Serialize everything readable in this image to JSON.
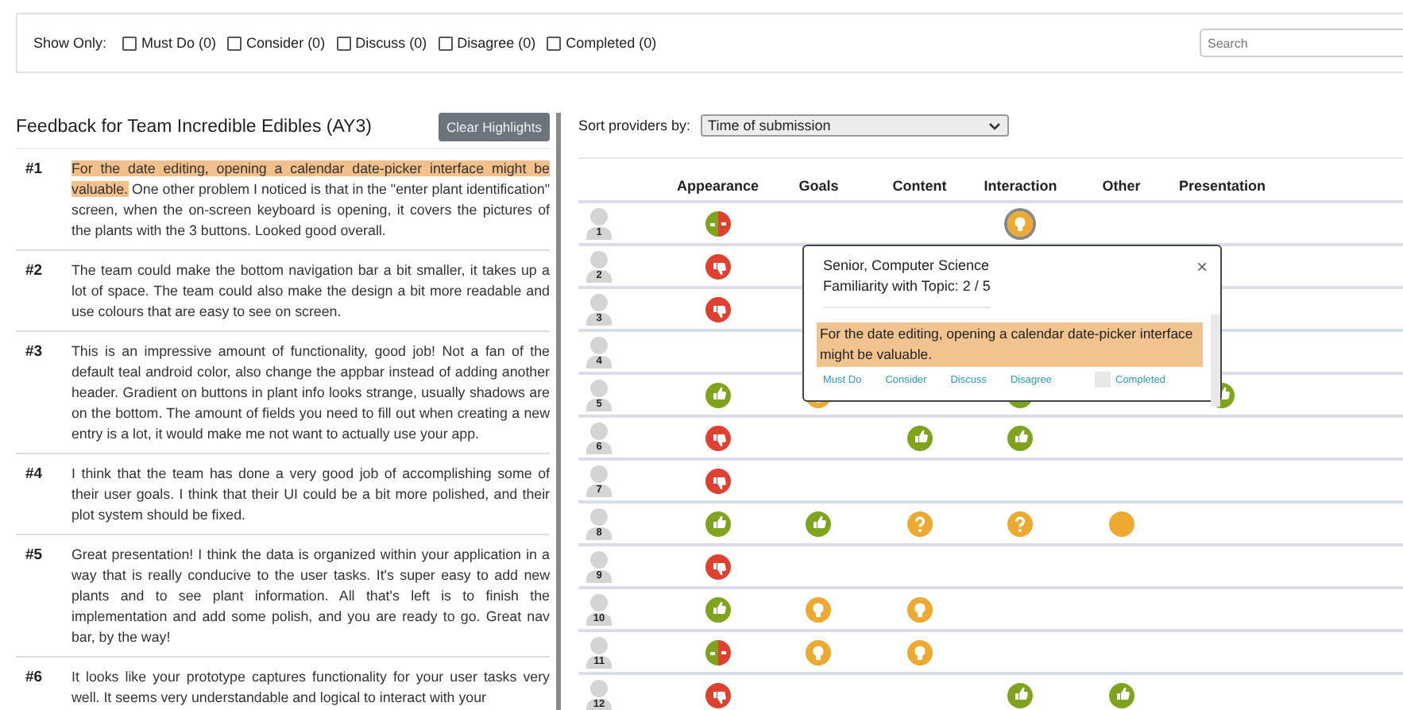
{
  "filter_bar": {
    "label": "Show Only:",
    "options": [
      {
        "label": "Must Do (0)",
        "checked": false
      },
      {
        "label": "Consider (0)",
        "checked": false
      },
      {
        "label": "Discuss (0)",
        "checked": false
      },
      {
        "label": "Disagree (0)",
        "checked": false
      },
      {
        "label": "Completed (0)",
        "checked": false
      }
    ],
    "search": {
      "placeholder": "Search"
    }
  },
  "feedback": {
    "title": "Feedback for Team Incredible Edibles (AY3)",
    "clear_button": "Clear Highlights",
    "items": [
      {
        "number": "#1",
        "highlight": "For the date editing, opening a calendar date-picker interface might be valuable.",
        "text": "One other problem I noticed is that in the \"enter plant identification\" screen, when the on-screen keyboard is opening, it covers the pictures of the plants with the 3 buttons. Looked good overall."
      },
      {
        "number": "#2",
        "text": "The team could make the bottom navigation bar a bit smaller, it takes up a lot of space. The team could also make the design a bit more readable and use colours that are easy to see on screen."
      },
      {
        "number": "#3",
        "text": "This is an impressive amount of functionality, good job! Not a fan of the default teal android color, also change the appbar instead of adding another header. Gradient on buttons in plant info looks strange, usually shadows are on the bottom. The amount of fields you need to fill out when creating a new entry is a lot, it would make me not want to actually use your app."
      },
      {
        "number": "#4",
        "text": "I think that the team has done a very good job of accomplishing some of their user goals. I think that their UI could be a bit more polished, and their plot system should be fixed."
      },
      {
        "number": "#5",
        "text": "Great presentation! I think the data is organized within your application in a way that is really conducive to the user tasks. It's super easy to add new plants and to see plant information. All that's left is to finish the implementation and add some polish, and you are ready to go. Great nav bar, by the way!"
      },
      {
        "number": "#6",
        "text": "It looks like your prototype captures functionality for your user tasks very well. It seems very understandable and logical to interact with your"
      }
    ]
  },
  "sort": {
    "label": "Sort providers by:",
    "value": "Time of submission"
  },
  "grid": {
    "columns": [
      "Appearance",
      "Goals",
      "Content",
      "Interaction",
      "Other",
      "Presentation"
    ],
    "rows": [
      {
        "number": "1",
        "cells": [
          {
            "kind": "mixed",
            "selected": false
          },
          {},
          {},
          {
            "kind": "idea",
            "selected": true
          },
          {},
          {}
        ]
      },
      {
        "number": "2",
        "cells": [
          {
            "kind": "down",
            "selected": false
          },
          {},
          {},
          {},
          {},
          {}
        ]
      },
      {
        "number": "3",
        "cells": [
          {
            "kind": "down",
            "selected": false
          },
          {},
          {},
          {},
          {},
          {}
        ]
      },
      {
        "number": "4",
        "cells": [
          {},
          {},
          {},
          {},
          {},
          {}
        ]
      },
      {
        "number": "5",
        "cells": [
          {
            "kind": "up",
            "selected": false
          },
          {
            "kind": "idea"
          },
          {},
          {
            "kind": "up"
          },
          {},
          {
            "kind": "up",
            "selected": false
          }
        ]
      },
      {
        "number": "6",
        "cells": [
          {
            "kind": "down",
            "selected": false
          },
          {},
          {
            "kind": "up",
            "selected": false
          },
          {
            "kind": "up",
            "selected": false
          },
          {},
          {}
        ]
      },
      {
        "number": "7",
        "cells": [
          {
            "kind": "down",
            "selected": false
          },
          {},
          {},
          {},
          {},
          {}
        ]
      },
      {
        "number": "8",
        "cells": [
          {
            "kind": "up",
            "selected": false
          },
          {
            "kind": "up",
            "selected": false
          },
          {
            "kind": "question",
            "selected": false
          },
          {
            "kind": "question",
            "selected": false
          },
          {
            "kind": "dot",
            "selected": false
          },
          {}
        ]
      },
      {
        "number": "9",
        "cells": [
          {
            "kind": "down",
            "selected": false
          },
          {},
          {},
          {},
          {},
          {}
        ]
      },
      {
        "number": "10",
        "cells": [
          {
            "kind": "up",
            "selected": false
          },
          {
            "kind": "idea",
            "selected": false
          },
          {
            "kind": "idea",
            "selected": false
          },
          {},
          {},
          {}
        ]
      },
      {
        "number": "11",
        "cells": [
          {
            "kind": "mixed",
            "selected": false
          },
          {
            "kind": "idea",
            "selected": false
          },
          {
            "kind": "idea",
            "selected": false
          },
          {},
          {},
          {}
        ]
      },
      {
        "number": "12",
        "cells": [
          {
            "kind": "down",
            "selected": false
          },
          {},
          {},
          {
            "kind": "up",
            "selected": false
          },
          {
            "kind": "up",
            "selected": false
          },
          {}
        ]
      }
    ]
  },
  "popup": {
    "lines": [
      "Senior, Computer Science",
      "Familiarity with Topic: 2 / 5"
    ],
    "close": "×",
    "highlight": "For the date editing, opening a calendar date-picker interface might be valuable.",
    "actions": [
      "Must Do",
      "Consider",
      "Discuss",
      "Disagree"
    ],
    "completed": {
      "label": "Completed",
      "checked": false
    }
  }
}
